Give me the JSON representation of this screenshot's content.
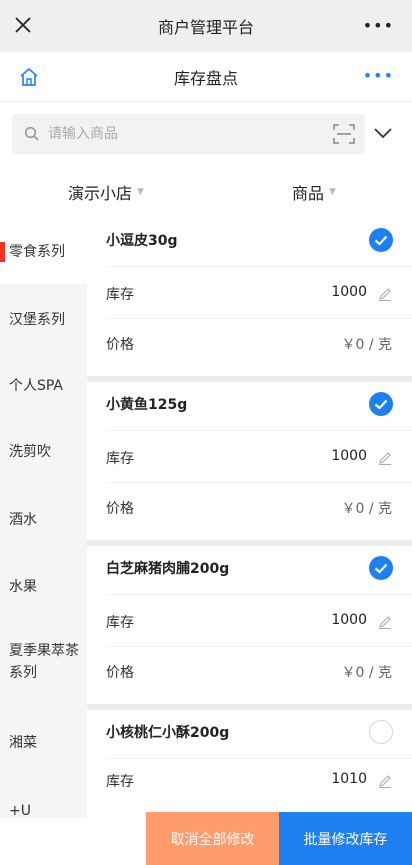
{
  "wechat_bar": {
    "title": "商户管理平台",
    "more": "•••"
  },
  "app_header": {
    "title": "库存盘点",
    "more": "•••"
  },
  "search": {
    "placeholder": "请输入商品",
    "value": ""
  },
  "filters": {
    "store": "演示小店",
    "goods": "商品"
  },
  "categories": [
    {
      "label": "零食系列",
      "active": true
    },
    {
      "label": "汉堡系列",
      "active": false
    },
    {
      "label": "个人SPA",
      "active": false
    },
    {
      "label": "洗剪吹",
      "active": false
    },
    {
      "label": "酒水",
      "active": false
    },
    {
      "label": "水果",
      "active": false
    },
    {
      "label": "夏季果萃茶系列",
      "active": false
    },
    {
      "label": "湘菜",
      "active": false
    },
    {
      "label": "+U",
      "active": false
    }
  ],
  "products": [
    {
      "name": "小逗皮30g",
      "stock_label": "库存",
      "stock": "1000",
      "price_label": "价格",
      "price": "￥0 / 克",
      "checked": true
    },
    {
      "name": "小黄鱼125g",
      "stock_label": "库存",
      "stock": "1000",
      "price_label": "价格",
      "price": "￥0 / 克",
      "checked": true
    },
    {
      "name": "白芝麻猪肉脯200g",
      "stock_label": "库存",
      "stock": "1000",
      "price_label": "价格",
      "price": "￥0 / 克",
      "checked": true
    },
    {
      "name": "小核桃仁小酥200g",
      "stock_label": "库存",
      "stock": "1010",
      "price_label": "价格",
      "price": "",
      "checked": false
    }
  ],
  "actions": {
    "cancel_all": "取消全部修改",
    "batch_edit": "批量修改库存"
  },
  "colors": {
    "accent": "#1e7ff0",
    "cancel": "#ff9c6e",
    "active_marker": "#e33322"
  }
}
